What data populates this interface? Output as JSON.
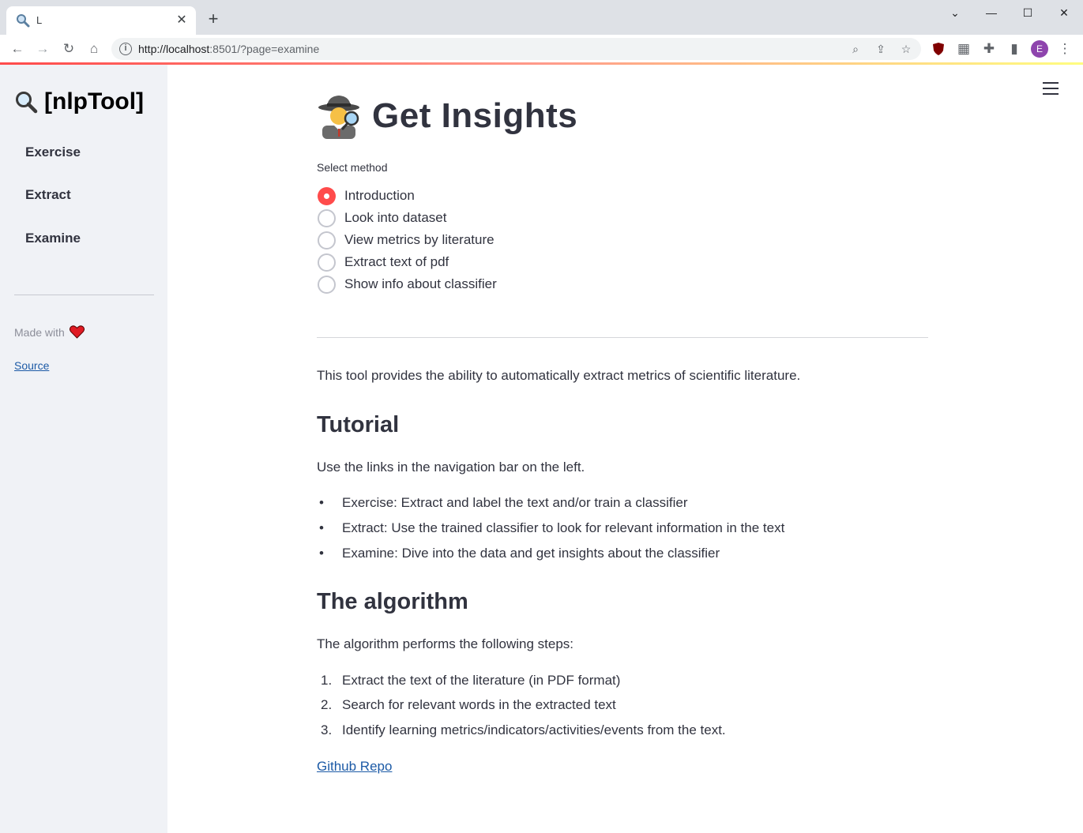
{
  "browser": {
    "tab_title": "L",
    "url_host": "http://localhost",
    "url_rest": ":8501/?page=examine",
    "profile_initial": "E"
  },
  "sidebar": {
    "title": "[nlpTool]",
    "nav": [
      "Exercise",
      "Extract",
      "Examine"
    ],
    "made_with": "Made with",
    "source_link": "Source"
  },
  "main": {
    "title": "Get Insights",
    "select_label": "Select method",
    "options": [
      {
        "label": "Introduction",
        "selected": true
      },
      {
        "label": "Look into dataset",
        "selected": false
      },
      {
        "label": "View metrics by literature",
        "selected": false
      },
      {
        "label": "Extract text of pdf",
        "selected": false
      },
      {
        "label": "Show info about classifier",
        "selected": false
      }
    ],
    "intro": "This tool provides the ability to automatically extract metrics of scientific literature.",
    "tutorial_heading": "Tutorial",
    "tutorial_text": "Use the links in the navigation bar on the left.",
    "tutorial_items": [
      "Exercise: Extract and label the text and/or train a classifier",
      "Extract: Use the trained classifier to look for relevant information in the text",
      "Examine: Dive into the data and get insights about the classifier"
    ],
    "algorithm_heading": "The algorithm",
    "algorithm_text": "The algorithm performs the following steps:",
    "algorithm_steps": [
      "Extract the text of the literature (in PDF format)",
      "Search for relevant words in the extracted text",
      "Identify learning metrics/indicators/activities/events from the text."
    ],
    "step_numbers": [
      "1.",
      "2.",
      "3."
    ],
    "github_link": "Github Repo"
  },
  "colors": {
    "accent": "#ff4b4b",
    "sidebar_bg": "#f0f2f6",
    "text": "#31333f",
    "link": "#1c5aa6"
  }
}
